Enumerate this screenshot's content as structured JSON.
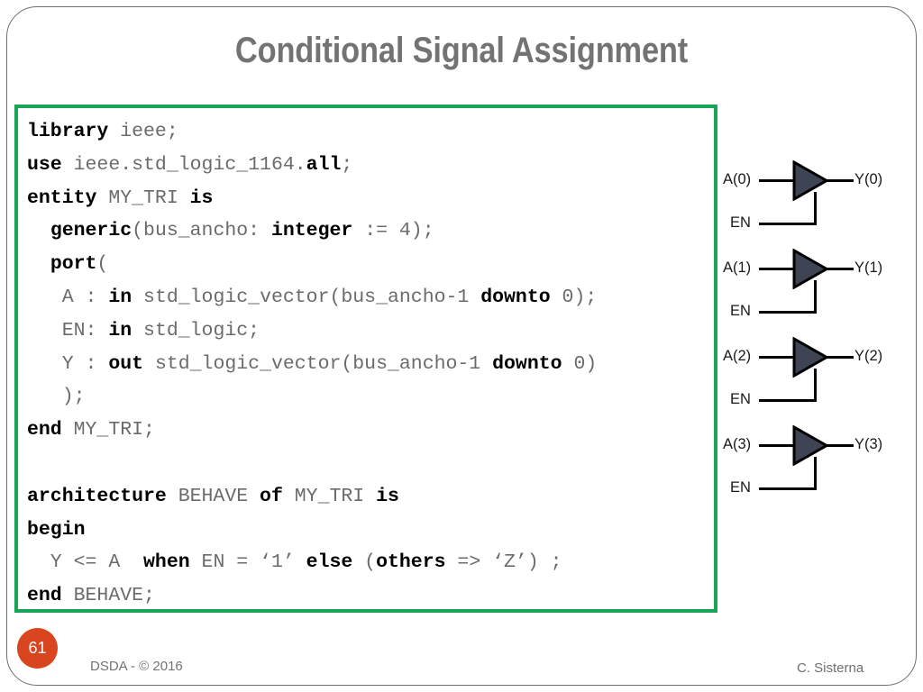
{
  "slide": {
    "title": "Conditional Signal Assignment",
    "page_number": "61",
    "footer_left": "DSDA - © 2016",
    "footer_right": "C. Sisterna",
    "colors": {
      "code_border_green": "#18a558",
      "badge_orange": "#d9451e",
      "title_gray": "#737373",
      "buffer_fill": "#3f4454",
      "code_plain": "#6b6b6b",
      "code_bold": "#000000"
    }
  },
  "code": {
    "language": "VHDL",
    "lines": [
      [
        {
          "t": "library",
          "b": true
        },
        {
          "t": " ieee;",
          "b": false
        }
      ],
      [
        {
          "t": "use",
          "b": true
        },
        {
          "t": " ieee.std_logic_1164.",
          "b": false
        },
        {
          "t": "all",
          "b": true
        },
        {
          "t": ";",
          "b": false
        }
      ],
      [
        {
          "t": "entity",
          "b": true
        },
        {
          "t": " MY_TRI ",
          "b": false
        },
        {
          "t": "is",
          "b": true
        }
      ],
      [
        {
          "t": "  ",
          "b": false
        },
        {
          "t": "generic",
          "b": true
        },
        {
          "t": "(bus_ancho: ",
          "b": false
        },
        {
          "t": "integer",
          "b": true
        },
        {
          "t": " := 4);",
          "b": false
        }
      ],
      [
        {
          "t": "  ",
          "b": false
        },
        {
          "t": "port",
          "b": true
        },
        {
          "t": "(",
          "b": false
        }
      ],
      [
        {
          "t": "   A : ",
          "b": false
        },
        {
          "t": "in",
          "b": true
        },
        {
          "t": " std_logic_vector(bus_ancho-1 ",
          "b": false
        },
        {
          "t": "downto",
          "b": true
        },
        {
          "t": " 0);",
          "b": false
        }
      ],
      [
        {
          "t": "   EN: ",
          "b": false
        },
        {
          "t": "in",
          "b": true
        },
        {
          "t": " std_logic;",
          "b": false
        }
      ],
      [
        {
          "t": "   Y : ",
          "b": false
        },
        {
          "t": "out",
          "b": true
        },
        {
          "t": " std_logic_vector(bus_ancho-1 ",
          "b": false
        },
        {
          "t": "downto",
          "b": true
        },
        {
          "t": " 0)",
          "b": false
        }
      ],
      [
        {
          "t": "   );",
          "b": false
        }
      ],
      [
        {
          "t": "end",
          "b": true
        },
        {
          "t": " MY_TRI;",
          "b": false
        }
      ],
      [
        {
          "t": " ",
          "b": false
        }
      ],
      [
        {
          "t": "architecture",
          "b": true
        },
        {
          "t": " BEHAVE ",
          "b": false
        },
        {
          "t": "of",
          "b": true
        },
        {
          "t": " MY_TRI ",
          "b": false
        },
        {
          "t": "is",
          "b": true
        }
      ],
      [
        {
          "t": "begin",
          "b": true
        }
      ],
      [
        {
          "t": "  Y <= A  ",
          "b": false
        },
        {
          "t": "when",
          "b": true
        },
        {
          "t": " EN = ‘1’ ",
          "b": false
        },
        {
          "t": "else",
          "b": true
        },
        {
          "t": " (",
          "b": false
        },
        {
          "t": "others",
          "b": true
        },
        {
          "t": " => ‘Z’) ;",
          "b": false
        }
      ],
      [
        {
          "t": "end",
          "b": true
        },
        {
          "t": " BEHAVE;",
          "b": false
        }
      ]
    ]
  },
  "diagram": {
    "name": "tri-state-buffer-bus",
    "buffers": [
      {
        "input": "A(0)",
        "output": "Y(0)",
        "enable": "EN"
      },
      {
        "input": "A(1)",
        "output": "Y(1)",
        "enable": "EN"
      },
      {
        "input": "A(2)",
        "output": "Y(2)",
        "enable": "EN"
      },
      {
        "input": "A(3)",
        "output": "Y(3)",
        "enable": "EN"
      }
    ]
  }
}
